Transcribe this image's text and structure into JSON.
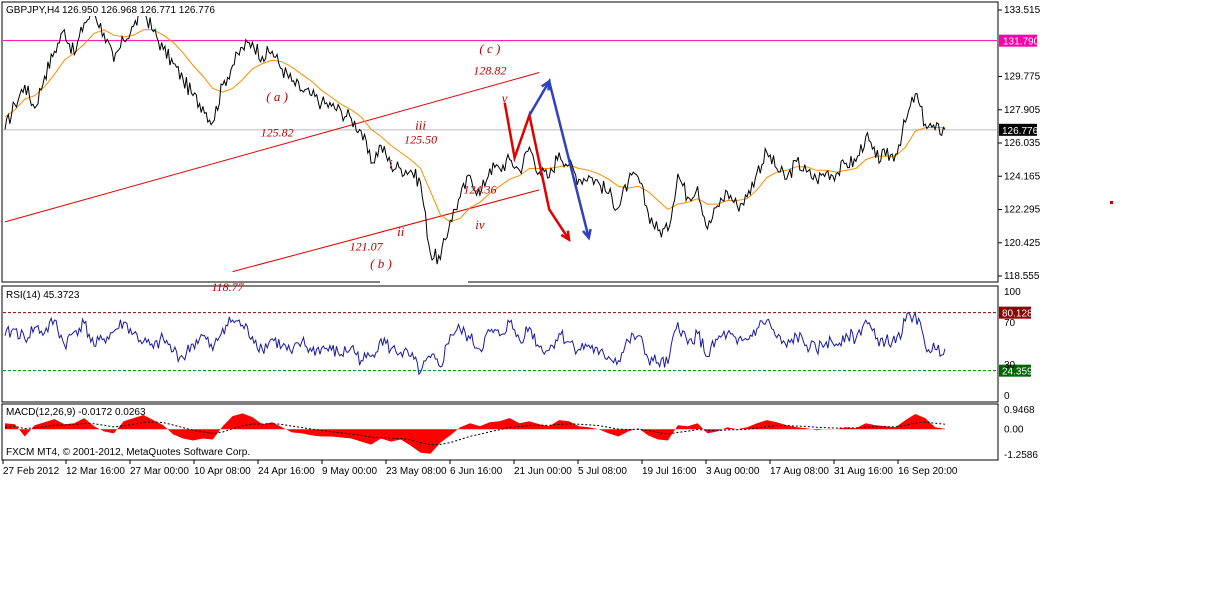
{
  "header": {
    "symbol_info": "GBPJPY,H4  126.950 126.968 126.771 126.776"
  },
  "footer": {
    "copyright": "FXCM MT4, © 2001-2012, MetaQuotes Software Corp."
  },
  "colors": {
    "background": "#ffffff",
    "price_line": "#000000",
    "moving_average": "#ff8c00",
    "channel": "#e00000",
    "resistance": "#ff00aa",
    "rsi": "#1a1aa0",
    "macd_hist": "#ff0000",
    "projection_red": "#e00000",
    "projection_blue": "#3040c0",
    "wave_labels": "#c00000"
  },
  "chart_data": [
    {
      "type": "line",
      "panel": "price",
      "title": "GBPJPY,H4",
      "ohlc_readout": {
        "open": 126.95,
        "high": 126.968,
        "low": 126.771,
        "close": 126.776
      },
      "y_ticks": [
        "133.515",
        "129.775",
        "127.905",
        "126.035",
        "124.165",
        "122.295",
        "120.425",
        "118.555"
      ],
      "ylim": [
        118.555,
        133.515
      ],
      "x_ticks": [
        "27 Feb 2012",
        "12 Mar 16:00",
        "27 Mar 00:00",
        "10 Apr 08:00",
        "24 Apr 16:00",
        "9 May 00:00",
        "23 May 08:00",
        "6 Jun 16:00",
        "21 Jun 00:00",
        "5 Jul 08:00",
        "19 Jul 16:00",
        "3 Aug 00:00",
        "17 Aug 08:00",
        "31 Aug 16:00",
        "16 Sep 20:00"
      ],
      "series": [
        {
          "values": [
            126.8,
            128.2,
            129.3,
            128.0,
            129.8,
            131.2,
            132.4,
            131.0,
            132.8,
            133.4,
            132.2,
            130.6,
            131.8,
            132.6,
            133.5,
            132.3,
            131.3,
            130.5,
            129.6,
            128.7,
            128.1,
            127.2,
            129.3,
            130.4,
            131.4,
            131.7,
            130.9,
            131.2,
            130.2,
            129.5,
            129.0,
            128.7,
            128.3,
            128.1,
            127.8,
            127.4,
            126.7,
            124.9,
            125.9,
            124.8,
            124.6,
            124.5,
            123.8,
            119.8,
            119.5,
            121.7,
            123.0,
            124.2,
            123.1,
            124.6,
            124.6,
            125.1,
            124.5,
            125.8,
            124.4,
            124.1,
            125.5,
            124.8,
            124.0,
            124.2,
            123.8,
            123.2,
            122.4,
            123.9,
            124.1,
            122.1,
            121.1,
            121.1,
            124.3,
            123.0,
            123.6,
            121.2,
            122.5,
            123.3,
            122.5,
            123.0,
            124.4,
            125.5,
            124.6,
            124.0,
            125.0,
            124.4,
            124.0,
            124.4,
            124.3,
            124.9,
            125.0,
            126.4,
            125.2,
            125.3,
            125.4,
            127.2,
            128.8,
            127.1,
            126.8,
            126.8
          ]
        },
        {
          "name": "MA",
          "values": [
            127.5,
            127.9,
            128.5,
            128.7,
            129.2,
            129.9,
            130.7,
            131.1,
            131.6,
            132.2,
            132.4,
            132.1,
            132.0,
            132.1,
            132.4,
            132.4,
            132.1,
            131.7,
            131.1,
            130.4,
            129.8,
            129.1,
            128.9,
            129.1,
            129.6,
            130.2,
            130.5,
            130.7,
            130.6,
            130.3,
            129.9,
            129.5,
            129.0,
            128.6,
            128.2,
            127.9,
            127.5,
            126.8,
            126.4,
            125.9,
            125.5,
            125.1,
            124.6,
            123.3,
            122.0,
            121.6,
            121.8,
            122.4,
            122.7,
            123.2,
            123.6,
            124.0,
            124.2,
            124.6,
            124.6,
            124.6,
            124.7,
            124.8,
            124.6,
            124.5,
            124.3,
            124.0,
            123.6,
            123.5,
            123.6,
            123.3,
            122.8,
            122.3,
            122.6,
            122.7,
            122.9,
            122.6,
            122.6,
            122.8,
            122.8,
            122.9,
            123.4,
            124.1,
            124.4,
            124.5,
            124.7,
            124.7,
            124.5,
            124.5,
            124.4,
            124.5,
            124.6,
            125.1,
            125.3,
            125.3,
            125.3,
            125.8,
            126.7,
            126.9,
            126.9,
            126.9
          ]
        }
      ],
      "horizontal_levels": [
        {
          "value": 131.79,
          "label": "131.790",
          "color": "#ff00aa"
        }
      ],
      "current_price_tag": "126.776",
      "wave_labels": [
        {
          "text": "( a )",
          "x": 27.5,
          "y": 128.4
        },
        {
          "text": "125.82",
          "x": 27.5,
          "y": 126.4
        },
        {
          "text": "118.77",
          "x": 22.5,
          "y": 117.7
        },
        {
          "text": "121.07",
          "x": 36.5,
          "y": 120.0
        },
        {
          "text": "( b )",
          "x": 38.0,
          "y": 119.0
        },
        {
          "text": "i",
          "x": 39.0,
          "y": 124.6
        },
        {
          "text": "ii",
          "x": 40.0,
          "y": 120.8
        },
        {
          "text": "iii",
          "x": 42.0,
          "y": 126.8
        },
        {
          "text": "125.50",
          "x": 42.0,
          "y": 126.0
        },
        {
          "text": "124.36",
          "x": 48.0,
          "y": 123.2
        },
        {
          "text": "iv",
          "x": 48.0,
          "y": 121.2
        },
        {
          "text": "( c )",
          "x": 49.0,
          "y": 131.1
        },
        {
          "text": "128.82",
          "x": 49.0,
          "y": 129.9
        },
        {
          "text": "v",
          "x": 50.5,
          "y": 128.3
        }
      ],
      "channel_lines": [
        {
          "name": "upper",
          "from": [
            0,
            121.6
          ],
          "to": [
            54.0,
            130.0
          ]
        },
        {
          "name": "lower",
          "from": [
            23.0,
            118.8
          ],
          "to": [
            54.0,
            123.4
          ]
        }
      ],
      "projections": [
        {
          "name": "red-path",
          "points": [
            [
              50.5,
              128.3
            ],
            [
              51.5,
              125.2
            ],
            [
              53.0,
              127.6
            ],
            [
              55.0,
              122.3
            ],
            [
              57.0,
              120.6
            ]
          ]
        },
        {
          "name": "blue-path",
          "points": [
            [
              53.0,
              127.6
            ],
            [
              55.0,
              129.5
            ],
            [
              59.0,
              120.7
            ]
          ]
        }
      ]
    },
    {
      "type": "line",
      "panel": "rsi",
      "title": "RSI(14) 45.3723",
      "y_ticks": [
        "100",
        "70",
        "30",
        "0"
      ],
      "ylim": [
        0,
        100
      ],
      "levels": [
        {
          "value": 80.128,
          "label": "80.128"
        },
        {
          "value": 24.359,
          "label": "24.359"
        }
      ],
      "series": [
        {
          "name": "RSI(14)",
          "values": [
            58,
            64,
            55,
            66,
            61,
            73,
            49,
            62,
            70,
            48,
            55,
            62,
            71,
            60,
            52,
            46,
            55,
            43,
            37,
            50,
            58,
            44,
            65,
            73,
            68,
            57,
            45,
            55,
            48,
            41,
            52,
            43,
            46,
            44,
            40,
            47,
            34,
            38,
            55,
            45,
            42,
            38,
            23,
            37,
            28,
            59,
            64,
            55,
            45,
            62,
            58,
            71,
            54,
            66,
            47,
            44,
            60,
            52,
            45,
            49,
            40,
            38,
            34,
            53,
            58,
            36,
            32,
            31,
            71,
            50,
            60,
            38,
            54,
            60,
            50,
            54,
            65,
            73,
            56,
            47,
            58,
            49,
            44,
            52,
            50,
            60,
            55,
            73,
            55,
            53,
            51,
            72,
            80,
            48,
            45,
            45.37
          ]
        }
      ]
    },
    {
      "type": "area",
      "panel": "macd",
      "title": "MACD(12,26,9) -0.0172 0.0263",
      "y_ticks": [
        "0.9468",
        "0.00",
        "-1.2586"
      ],
      "ylim": [
        -1.2586,
        0.9468
      ],
      "series": [
        {
          "name": "MACD",
          "values": [
            0.3,
            0.25,
            -0.35,
            0.2,
            0.35,
            0.5,
            0.25,
            0.3,
            0.55,
            0.15,
            -0.1,
            -0.2,
            0.4,
            0.55,
            0.7,
            0.45,
            0.2,
            -0.25,
            -0.45,
            -0.55,
            -0.45,
            -0.5,
            0.15,
            0.65,
            0.78,
            0.6,
            0.25,
            0.35,
            0.1,
            -0.15,
            -0.2,
            -0.3,
            -0.35,
            -0.35,
            -0.4,
            -0.45,
            -0.6,
            -0.75,
            -0.45,
            -0.6,
            -0.5,
            -0.8,
            -1.15,
            -1.2,
            -0.65,
            -0.3,
            0.1,
            0.3,
            0.15,
            0.35,
            0.4,
            0.55,
            0.3,
            0.4,
            0.25,
            0.15,
            0.45,
            0.4,
            0.15,
            0.1,
            0.0,
            -0.2,
            -0.35,
            -0.1,
            0.05,
            -0.3,
            -0.5,
            -0.55,
            0.2,
            0.15,
            0.3,
            -0.2,
            -0.1,
            0.1,
            0.0,
            0.1,
            0.3,
            0.45,
            0.35,
            0.2,
            0.1,
            0.05,
            -0.05,
            0.02,
            0.0,
            0.1,
            0.05,
            0.3,
            0.2,
            0.15,
            0.1,
            0.45,
            0.75,
            0.55,
            0.1,
            0.03
          ]
        },
        {
          "name": "Signal",
          "values": [
            0.1,
            0.14,
            0.04,
            0.07,
            0.13,
            0.2,
            0.21,
            0.23,
            0.3,
            0.27,
            0.2,
            0.12,
            0.17,
            0.25,
            0.34,
            0.36,
            0.33,
            0.21,
            0.08,
            -0.05,
            -0.13,
            -0.2,
            -0.13,
            0.03,
            0.18,
            0.26,
            0.26,
            0.28,
            0.24,
            0.16,
            0.09,
            0.01,
            -0.06,
            -0.12,
            -0.18,
            -0.23,
            -0.3,
            -0.39,
            -0.4,
            -0.44,
            -0.45,
            -0.52,
            -0.65,
            -0.76,
            -0.74,
            -0.65,
            -0.5,
            -0.34,
            -0.24,
            -0.12,
            -0.02,
            0.1,
            0.14,
            0.19,
            0.2,
            0.19,
            0.24,
            0.27,
            0.25,
            0.22,
            0.18,
            0.1,
            0.01,
            -0.01,
            0.0,
            -0.06,
            -0.15,
            -0.23,
            -0.15,
            -0.09,
            -0.01,
            -0.05,
            -0.06,
            -0.03,
            -0.02,
            0.0,
            0.06,
            0.14,
            0.18,
            0.18,
            0.16,
            0.14,
            0.1,
            0.08,
            0.06,
            0.07,
            0.07,
            0.11,
            0.13,
            0.13,
            0.12,
            0.19,
            0.3,
            0.35,
            0.3,
            0.25
          ]
        }
      ]
    }
  ]
}
